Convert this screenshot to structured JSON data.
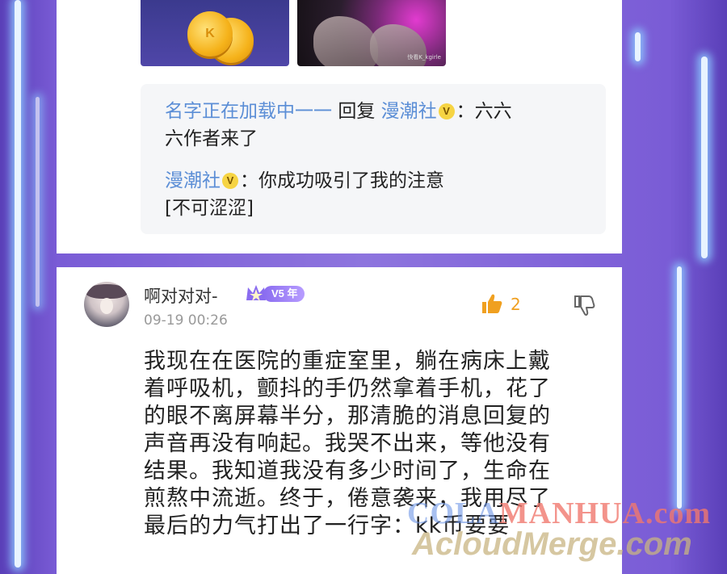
{
  "colors": {
    "background": "#7a5cd6",
    "name_link": "#5b8ed6",
    "like_accent": "#f0a020",
    "vip": "#8a6cf0"
  },
  "top_comment": {
    "thumbnails": [
      {
        "name": "coin-image",
        "letter": "K"
      },
      {
        "name": "photo-image",
        "caption": "快看K_kgirle"
      }
    ],
    "replies": [
      {
        "author": "名字正在加载中一一",
        "connector": "回复",
        "target": "漫潮社",
        "badge": "V",
        "text_line1": "：六六",
        "text_line2": "六作者来了"
      },
      {
        "author": "漫潮社",
        "badge": "V",
        "text_line1": "：你成功吸引了我的注意",
        "text_line2": "[不可涩涩]"
      }
    ]
  },
  "comment": {
    "username": "啊对对对-",
    "vip_label": "V5 年",
    "timestamp": "09-19 00:26",
    "like_count": "2",
    "body_lines": [
      "我现在在医院的重症室里，躺在病床上戴",
      "着呼吸机，颤抖的手仍然拿着手机，花了",
      "的眼不离屏幕半分，那清脆的消息回复的",
      "声音再没有响起。我哭不出来，等他没有",
      "结果。我知道我没有多少时间了，生命在",
      "煎熬中流逝。终于，倦意袭来，我用尽了",
      "最后的力气打出了一行字：kk币要要"
    ]
  },
  "watermark": {
    "line1_a": "COLA",
    "line1_b": "MANHUA.com",
    "line2": "AcloudMerge.com"
  }
}
